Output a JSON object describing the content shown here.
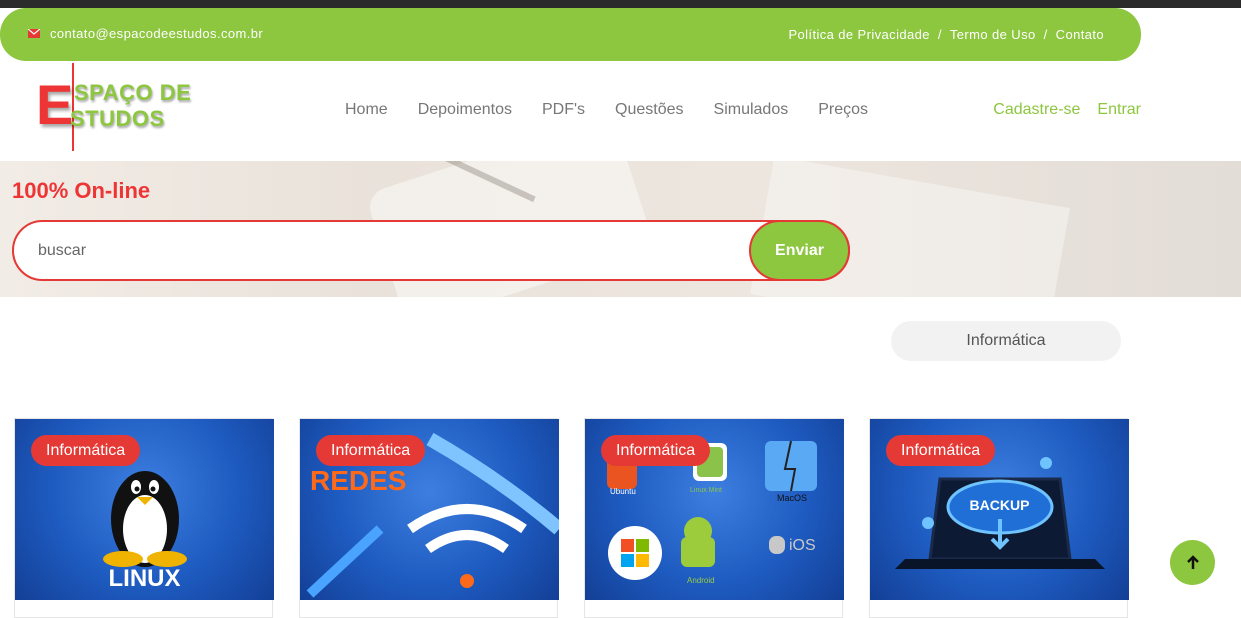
{
  "topbar": {
    "email": "contato@espacodeestudos.com.br",
    "links": [
      "Política de Privacidade",
      "Termo de Uso",
      "Contato"
    ],
    "separator": "/"
  },
  "logo": {
    "letter": "E",
    "line1": "SPAÇO DE",
    "line2": "STUDOS"
  },
  "nav": {
    "items": [
      "Home",
      "Depoimentos",
      "PDF's",
      "Questões",
      "Simulados",
      "Preços"
    ],
    "signup": "Cadastre-se",
    "login": "Entrar"
  },
  "hero": {
    "title": "100% On-line",
    "search_placeholder": "buscar",
    "search_button": "Enviar"
  },
  "filter": {
    "selected": "Informática"
  },
  "cards": [
    {
      "badge": "Informática",
      "image_text": "LINUX"
    },
    {
      "badge": "Informática",
      "image_text": "REDES"
    },
    {
      "badge": "Informática",
      "image_labels": [
        "Ubuntu",
        "Linux Mint",
        "MacOS",
        "Android",
        "iOS"
      ]
    },
    {
      "badge": "Informática",
      "image_text": "BACKUP"
    }
  ],
  "colors": {
    "green": "#8dc63f",
    "red": "#e53935",
    "dark": "#2b2b2b"
  }
}
